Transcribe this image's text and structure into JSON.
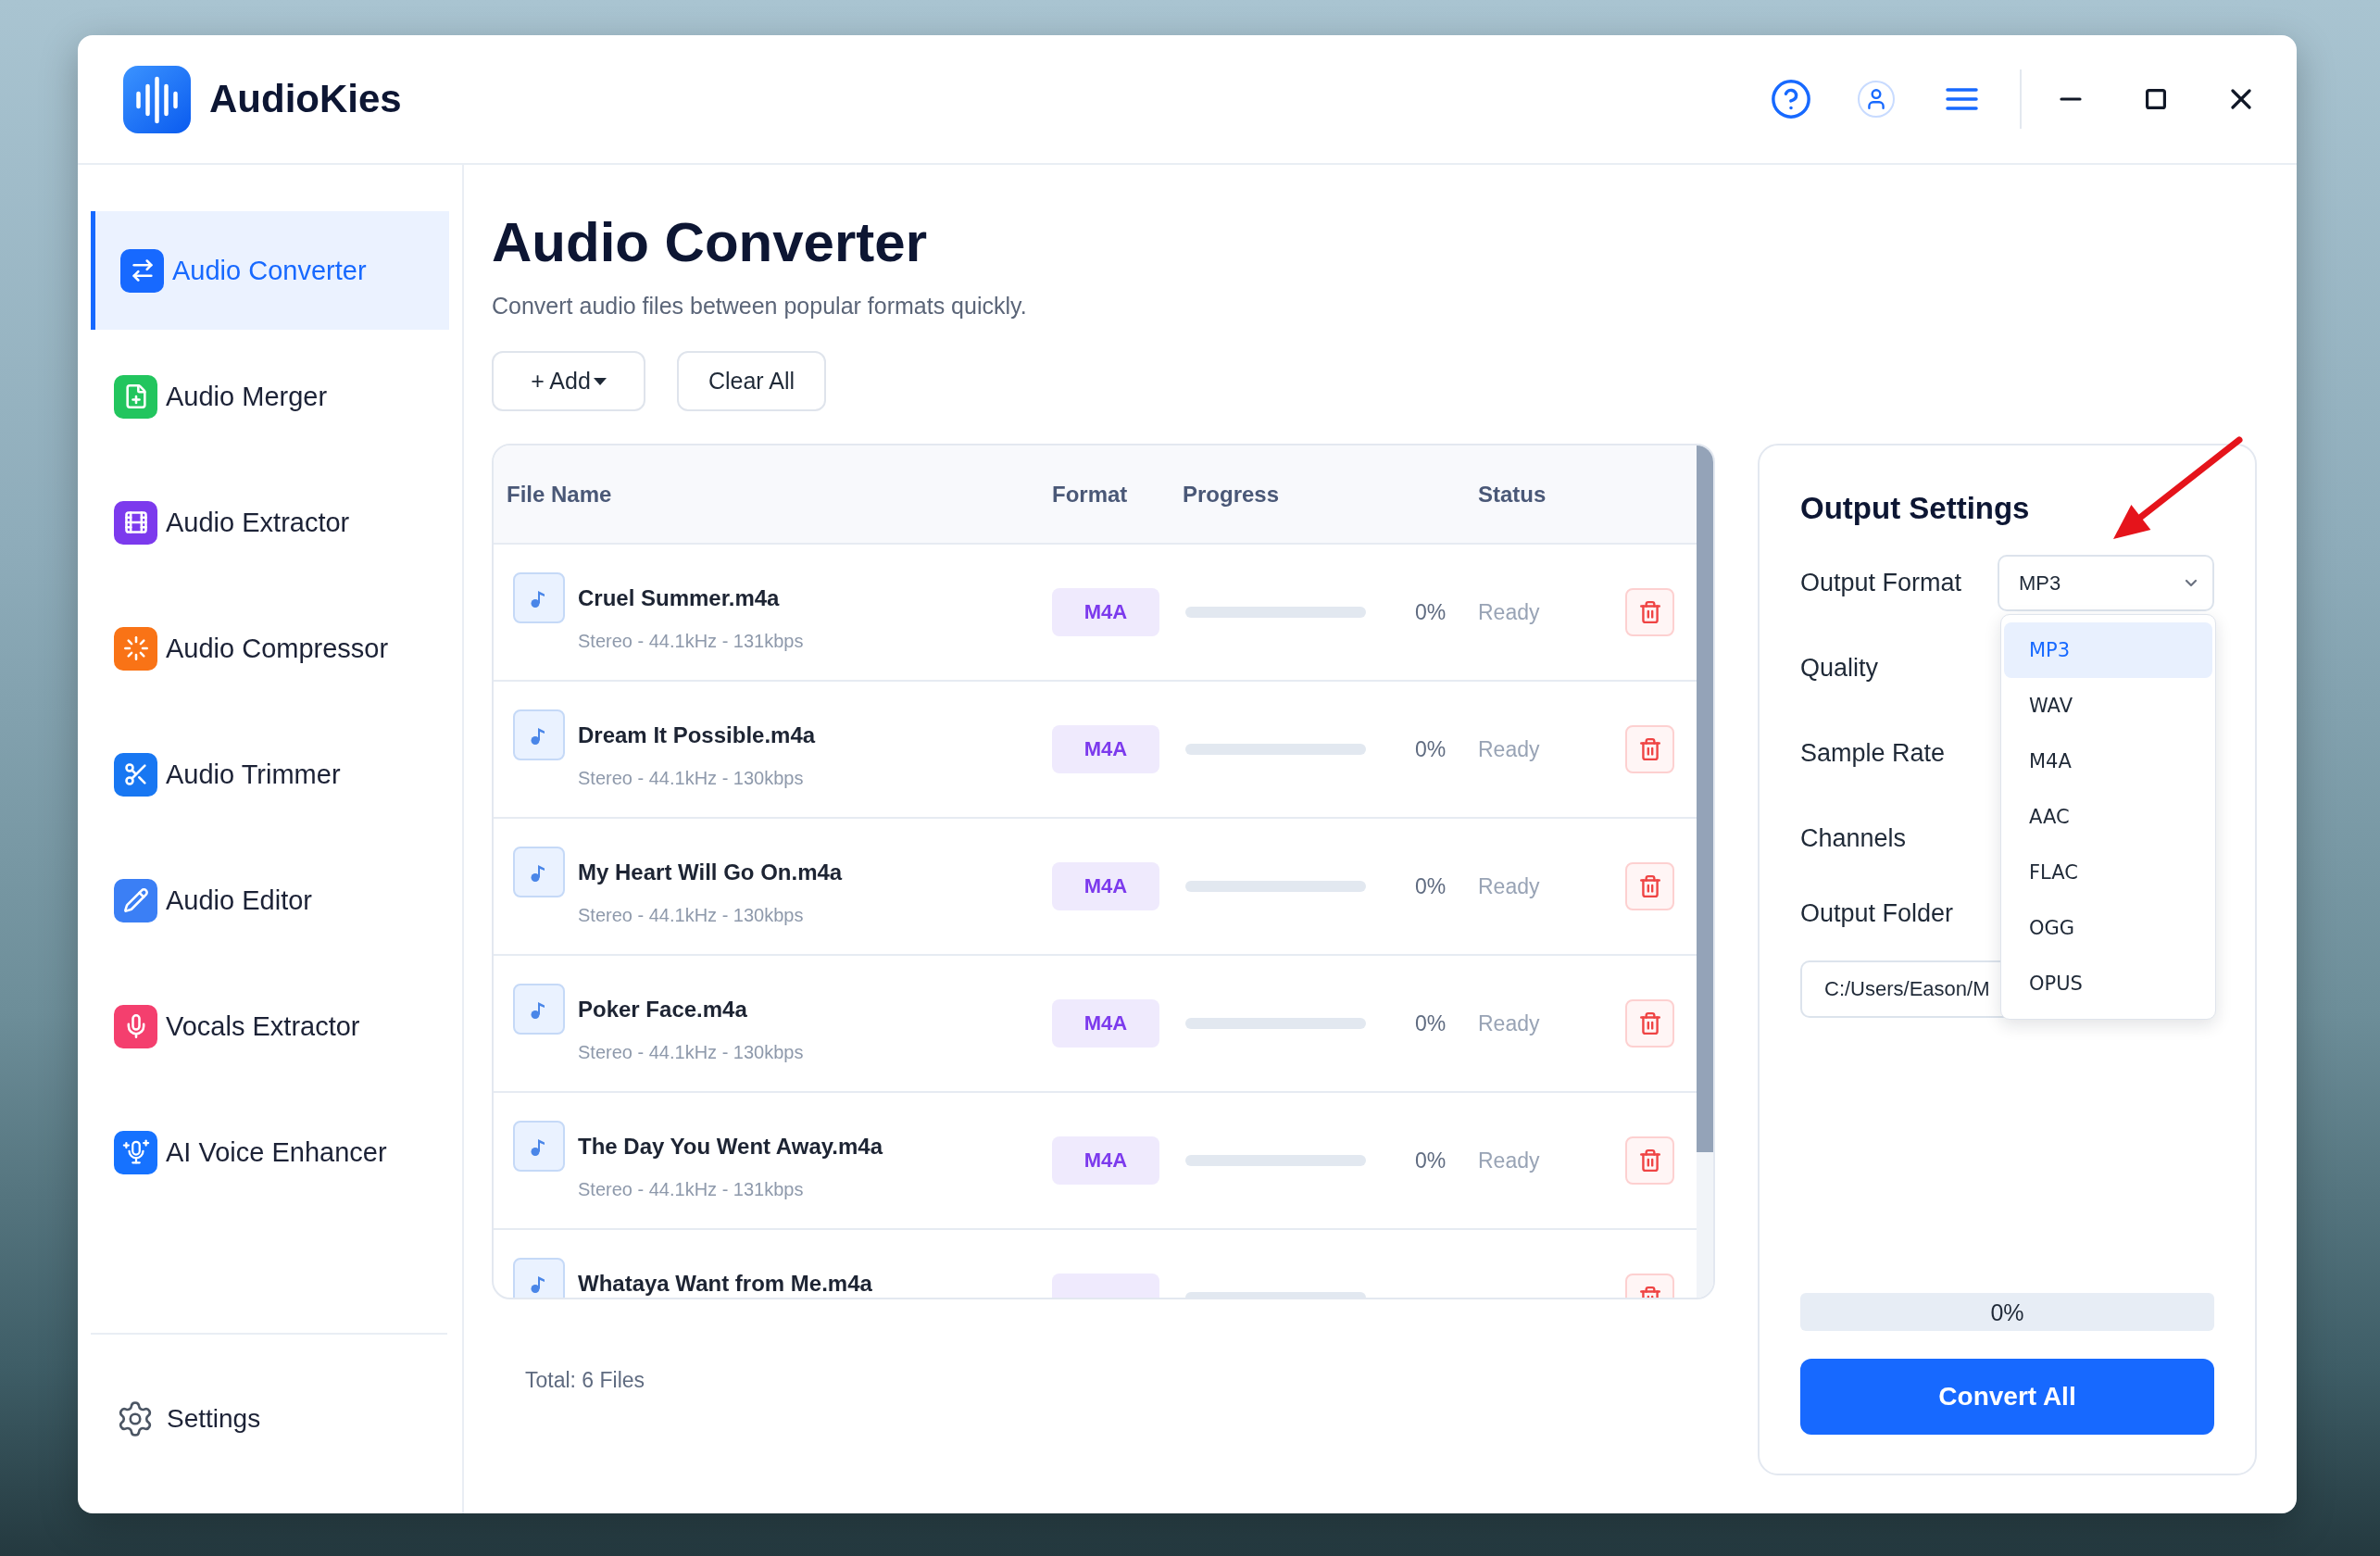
{
  "app": {
    "name": "AudioKies"
  },
  "sidebar": {
    "items": [
      {
        "label": "Audio Converter",
        "selected": true,
        "color": "#1769ff"
      },
      {
        "label": "Audio Merger",
        "selected": false,
        "color": "#22c55e"
      },
      {
        "label": "Audio Extractor",
        "selected": false,
        "color": "#7c3aed"
      },
      {
        "label": "Audio Compressor",
        "selected": false,
        "color": "#f97316"
      },
      {
        "label": "Audio Trimmer",
        "selected": false,
        "color": "#1877f2"
      },
      {
        "label": "Audio Editor",
        "selected": false,
        "color": "#3b7ff5"
      },
      {
        "label": "Vocals Extractor",
        "selected": false,
        "color": "#f43f6e"
      },
      {
        "label": "AI Voice Enhancer",
        "selected": false,
        "color": "#1672ff"
      }
    ],
    "settings": {
      "label": "Settings"
    }
  },
  "page": {
    "title": "Audio Converter",
    "subtitle": "Convert audio files between popular formats quickly."
  },
  "toolbar": {
    "buttons": [
      {
        "label": "+ Add",
        "kind": "menu"
      },
      {
        "label": "Clear All",
        "kind": "plain"
      }
    ]
  },
  "table": {
    "columns": [
      "File Name",
      "Format",
      "Progress",
      "Status"
    ],
    "rows": [
      {
        "name": "Cruel Summer.m4a",
        "meta": "Stereo - 44.1kHz - 131kbps",
        "format": "M4A",
        "level": 0,
        "reading": "0%",
        "status": "Ready"
      },
      {
        "name": "Dream It Possible.m4a",
        "meta": "Stereo - 44.1kHz - 130kbps",
        "format": "M4A",
        "level": 0,
        "reading": "0%",
        "status": "Ready"
      },
      {
        "name": "My Heart Will Go On.m4a",
        "meta": "Stereo - 44.1kHz - 130kbps",
        "format": "M4A",
        "level": 0,
        "reading": "0%",
        "status": "Ready"
      },
      {
        "name": "Poker Face.m4a",
        "meta": "Stereo - 44.1kHz - 130kbps",
        "format": "M4A",
        "level": 0,
        "reading": "0%",
        "status": "Ready"
      },
      {
        "name": "The Day You Went Away.m4a",
        "meta": "Stereo - 44.1kHz - 131kbps",
        "format": "M4A",
        "level": 0,
        "reading": "0%",
        "status": "Ready"
      },
      {
        "name": "Whataya Want from Me.m4a",
        "level": 0
      }
    ],
    "total": "Total: 6 Files"
  },
  "output_settings": {
    "title": "Output Settings",
    "format": {
      "label": "Output Format",
      "value": "MP3",
      "expanded": true,
      "options": [
        {
          "label": "MP3",
          "selected": true
        },
        {
          "label": "WAV",
          "selected": false
        },
        {
          "label": "M4A",
          "selected": false
        },
        {
          "label": "AAC",
          "selected": false
        },
        {
          "label": "FLAC",
          "selected": false
        },
        {
          "label": "OGG",
          "selected": false
        },
        {
          "label": "OPUS",
          "selected": false
        }
      ]
    },
    "fields": [
      {
        "label": "Quality"
      },
      {
        "label": "Sample Rate"
      },
      {
        "label": "Channels"
      }
    ],
    "folder": {
      "label": "Output Folder",
      "value": "C:/Users/Eason/M"
    },
    "progress": {
      "level": 0,
      "reading": "0%"
    },
    "convert_button": {
      "label": "Convert All"
    }
  }
}
